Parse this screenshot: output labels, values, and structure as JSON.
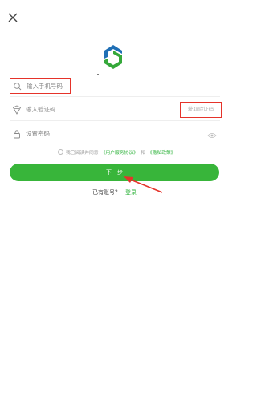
{
  "icons": {
    "close": "close-icon",
    "phone": "phone-icon",
    "code": "shield-icon",
    "password": "lock-icon",
    "eye": "eye-icon"
  },
  "colors": {
    "accent": "#38b53a",
    "link": "#2fb33c",
    "annotation": "#e5332a",
    "logo_blue": "#1f6fb5",
    "logo_green": "#35a83a"
  },
  "form": {
    "phone_placeholder": "输入手机号码",
    "code_placeholder": "输入验证码",
    "get_code_label": "获取验证码",
    "password_placeholder": "设置密码"
  },
  "agreement": {
    "prefix": "我已阅读并同意",
    "user_agreement": "《用户服务协议》",
    "and": "和",
    "privacy_policy": "《隐私政策》"
  },
  "next_label": "下一步",
  "footer": {
    "has_account": "已有账号？",
    "login_label": "登录"
  }
}
